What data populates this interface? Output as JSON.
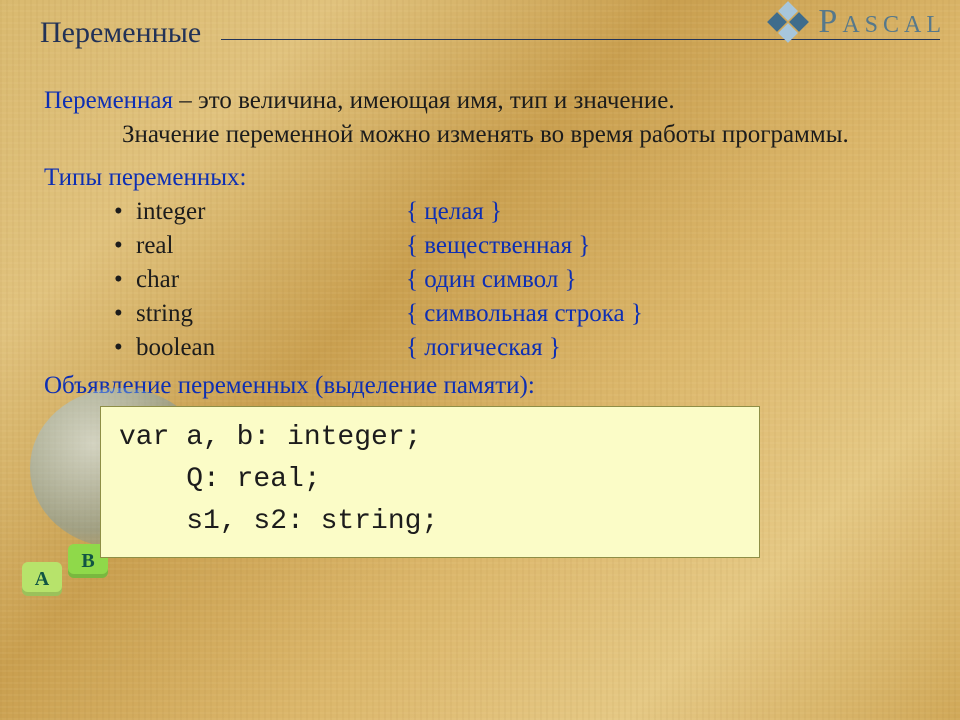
{
  "header": {
    "title": "Переменные",
    "logo_text": "Pascal"
  },
  "para": {
    "term": "Переменная",
    "dash_text": " – это величина, имеющая имя, тип и значение.",
    "cont": "Значение переменной можно изменять во время работы программы."
  },
  "types_heading": "Типы переменных:",
  "types": [
    {
      "name": "integer",
      "desc": "{ целая }"
    },
    {
      "name": "real",
      "desc": "{ вещественная }"
    },
    {
      "name": "char",
      "desc": "{ один символ }"
    },
    {
      "name": "string",
      "desc": "{ символьная строка }"
    },
    {
      "name": "boolean",
      "desc": "{ логическая }"
    }
  ],
  "decl_heading": "Объявление переменных (выделение памяти):",
  "code": {
    "l1": "var a, b: integer;",
    "l2": "    Q: real;",
    "l3": "    s1, s2: string;"
  },
  "globe_letters": {
    "a": "A",
    "b": "B"
  }
}
